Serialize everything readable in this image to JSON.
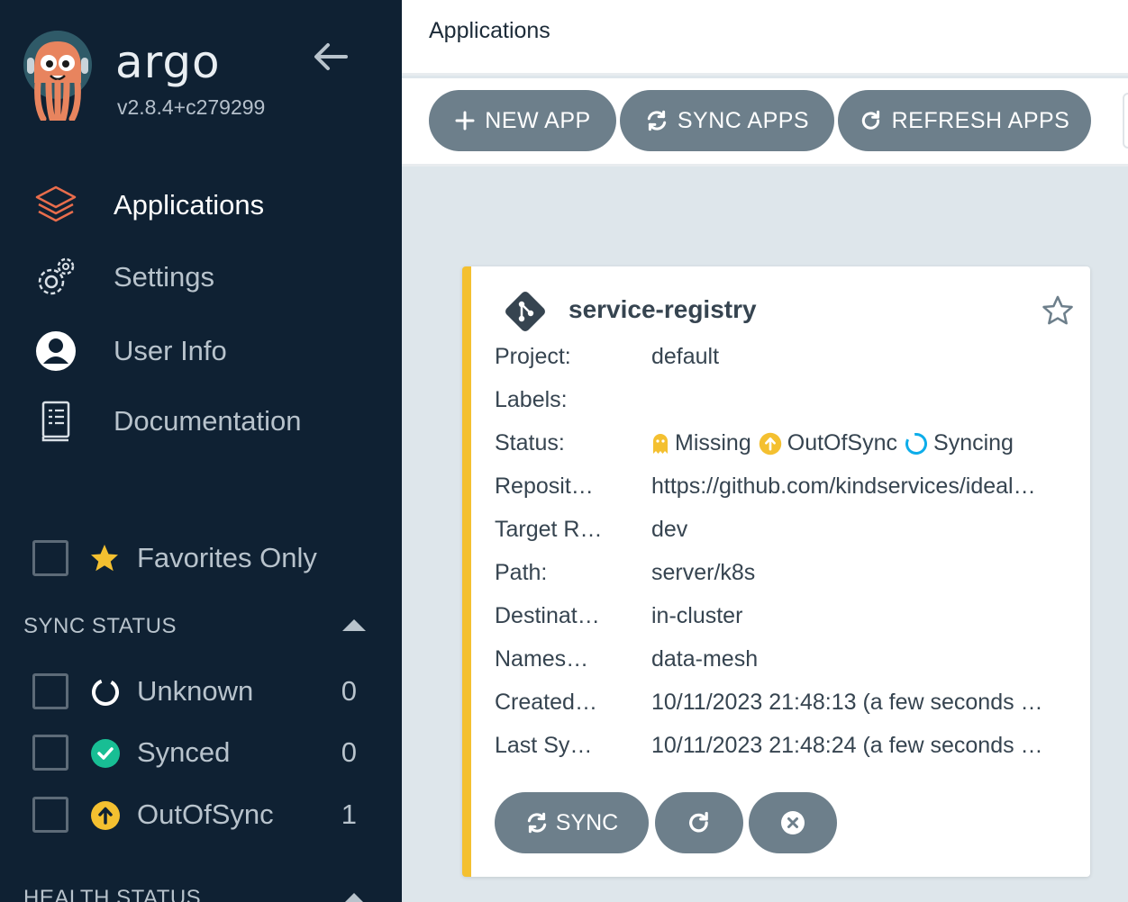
{
  "sidebar": {
    "brand": "argo",
    "version": "v2.8.4+c279299",
    "nav": [
      {
        "label": "Applications",
        "icon": "layers-icon",
        "active": true
      },
      {
        "label": "Settings",
        "icon": "gears-icon",
        "active": false
      },
      {
        "label": "User Info",
        "icon": "user-icon",
        "active": false
      },
      {
        "label": "Documentation",
        "icon": "book-icon",
        "active": false
      }
    ],
    "favorites_label": "Favorites Only",
    "sync_status": {
      "title": "SYNC STATUS",
      "items": [
        {
          "label": "Unknown",
          "count": "0",
          "icon": "circle-notch-icon"
        },
        {
          "label": "Synced",
          "count": "0",
          "icon": "check-circle-icon"
        },
        {
          "label": "OutOfSync",
          "count": "1",
          "icon": "arrow-up-circle-icon"
        }
      ]
    },
    "health_status": {
      "title": "HEALTH STATUS"
    }
  },
  "header": {
    "title": "Applications"
  },
  "toolbar": {
    "new_app": "NEW APP",
    "sync_apps": "SYNC APPS",
    "refresh_apps": "REFRESH APPS"
  },
  "app_card": {
    "name": "service-registry",
    "fields": {
      "project": {
        "key": "Project:",
        "value": "default"
      },
      "labels": {
        "key": "Labels:",
        "value": ""
      },
      "status": {
        "key": "Status:",
        "health": "Missing",
        "sync": "OutOfSync",
        "operation": "Syncing"
      },
      "repository": {
        "key": "Reposit…",
        "value": "https://github.com/kindservices/ideal…"
      },
      "target_revision": {
        "key": "Target R…",
        "value": "dev"
      },
      "path": {
        "key": "Path:",
        "value": "server/k8s"
      },
      "destination": {
        "key": "Destinat…",
        "value": "in-cluster"
      },
      "namespace": {
        "key": "Names…",
        "value": "data-mesh"
      },
      "created": {
        "key": "Created…",
        "value": "10/11/2023 21:48:13  (a few seconds …"
      },
      "last_sync": {
        "key": "Last Sy…",
        "value": "10/11/2023 21:48:24  (a few seconds …"
      }
    },
    "sync_button": "SYNC"
  },
  "colors": {
    "sidebar_bg": "#0f2133",
    "accent_orange": "#e96d4c",
    "outofsync_yellow": "#f4c030",
    "synced_green": "#18be94",
    "syncing_blue": "#0dadea",
    "button_gray": "#6d7f8b"
  }
}
